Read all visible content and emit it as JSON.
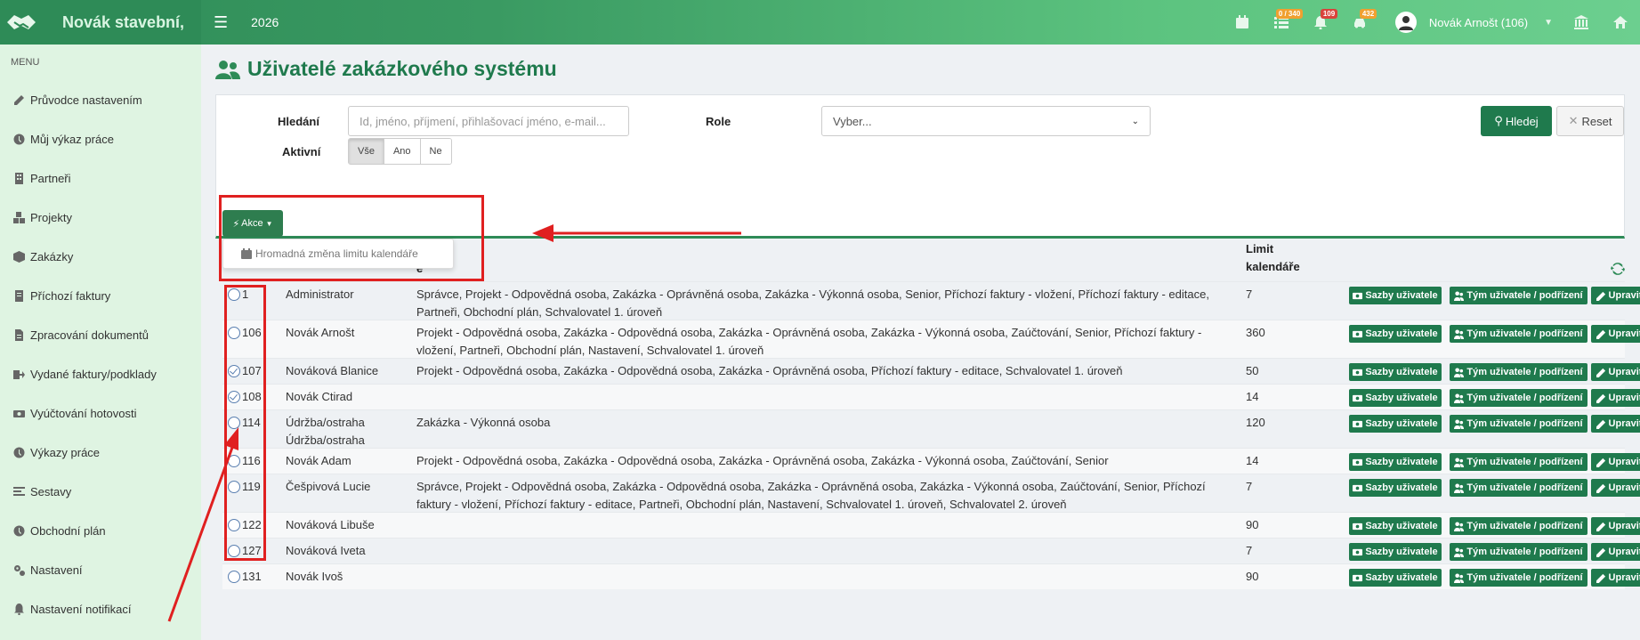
{
  "app": {
    "brand_name": "Novák stavební,",
    "year": "2026",
    "badges": {
      "tasks": "0 / 340",
      "notifications": "109",
      "vehicles": "432"
    },
    "user_name": "Novák Arnošt (106)"
  },
  "sidebar": {
    "menu_title": "MENU",
    "items": [
      {
        "label": "Průvodce nastavením",
        "icon": "pencil-icon"
      },
      {
        "label": "Můj výkaz práce",
        "icon": "clock-icon"
      },
      {
        "label": "Partneři",
        "icon": "building-icon"
      },
      {
        "label": "Projekty",
        "icon": "cubes-icon"
      },
      {
        "label": "Zakázky",
        "icon": "cube-icon"
      },
      {
        "label": "Příchozí faktury",
        "icon": "invoice-icon"
      },
      {
        "label": "Zpracování dokumentů",
        "icon": "document-icon"
      },
      {
        "label": "Vydané faktury/podklady",
        "icon": "export-icon"
      },
      {
        "label": "Vyúčtování hotovosti",
        "icon": "money-icon"
      },
      {
        "label": "Výkazy práce",
        "icon": "clock-icon"
      },
      {
        "label": "Sestavy",
        "icon": "list-icon"
      },
      {
        "label": "Obchodní plán",
        "icon": "clock-icon"
      },
      {
        "label": "Nastavení",
        "icon": "gears-icon"
      },
      {
        "label": "Nastavení notifikací",
        "icon": "bell-icon"
      }
    ]
  },
  "page": {
    "title": "Uživatelé zakázkového systému"
  },
  "filter": {
    "search_label": "Hledání",
    "search_placeholder": "Id, jméno, příjmení, přihlašovací jméno, e-mail...",
    "role_label": "Role",
    "role_value": "Vyber...",
    "active_label": "Aktivní",
    "active_options": [
      "Vše",
      "Ano",
      "Ne"
    ],
    "search_button": "Hledej",
    "reset_button": "Reset"
  },
  "actions": {
    "akce_button": "Akce",
    "dropdown_item": "Hromadná změna limitu kalendáře"
  },
  "table": {
    "header_role_partial": "e",
    "header_limit_line1": "Limit",
    "header_limit_line2": "kalendáře",
    "btn_sazby": "Sazby uživatele",
    "btn_tym": "Tým uživatele / podřízení",
    "btn_upravit": "Upravit",
    "rows": [
      {
        "id": "1",
        "name": "Administrator",
        "roles1": "Správce, Projekt - Odpovědná osoba, Zakázka - Oprávněná osoba, Zakázka - Výkonná osoba, Senior, Příchozí faktury - vložení, Příchozí faktury - editace,",
        "roles2": "Partneři, Obchodní plán, Schvalovatel 1. úroveň",
        "limit": "7",
        "checked": false
      },
      {
        "id": "106",
        "name": "Novák Arnošt",
        "roles1": "Projekt - Odpovědná osoba, Zakázka - Odpovědná osoba, Zakázka - Oprávněná osoba, Zakázka - Výkonná osoba, Zaúčtování, Senior, Příchozí faktury -",
        "roles2": "vložení, Partneři, Obchodní plán, Nastavení, Schvalovatel 1. úroveň",
        "limit": "360",
        "checked": false
      },
      {
        "id": "107",
        "name": "Nováková Blanice",
        "roles1": "Projekt - Odpovědná osoba, Zakázka - Odpovědná osoba, Zakázka - Oprávněná osoba, Příchozí faktury - editace, Schvalovatel 1. úroveň",
        "roles2": "",
        "limit": "50",
        "checked": true
      },
      {
        "id": "108",
        "name": "Novák Ctirad",
        "roles1": "",
        "roles2": "",
        "limit": "14",
        "checked": true
      },
      {
        "id": "114",
        "name": "Údržba/ostraha",
        "name2": "Údržba/ostraha",
        "roles1": "Zakázka - Výkonná osoba",
        "roles2": "",
        "limit": "120",
        "checked": false
      },
      {
        "id": "116",
        "name": "Novák Adam",
        "roles1": "Projekt - Odpovědná osoba, Zakázka - Odpovědná osoba, Zakázka - Oprávněná osoba, Zakázka - Výkonná osoba, Zaúčtování, Senior",
        "roles2": "",
        "limit": "14",
        "checked": false
      },
      {
        "id": "119",
        "name": "Češpivová Lucie",
        "roles1": "Správce, Projekt - Odpovědná osoba, Zakázka - Odpovědná osoba, Zakázka - Oprávněná osoba, Zakázka - Výkonná osoba, Zaúčtování, Senior, Příchozí",
        "roles2": "faktury - vložení, Příchozí faktury - editace, Partneři, Obchodní plán, Nastavení, Schvalovatel 1. úroveň, Schvalovatel 2. úroveň",
        "limit": "7",
        "checked": false
      },
      {
        "id": "122",
        "name": "Nováková Libuše",
        "roles1": "",
        "roles2": "",
        "limit": "90",
        "checked": false
      },
      {
        "id": "127",
        "name": "Nováková Iveta",
        "roles1": "",
        "roles2": "",
        "limit": "7",
        "checked": false
      },
      {
        "id": "131",
        "name": "Novák Ivoš",
        "roles1": "",
        "roles2": "",
        "limit": "90",
        "checked": false
      }
    ]
  },
  "colors": {
    "primary": "#1f7a4d",
    "sidebar_bg": "#dff4e2",
    "annotation": "#e02020"
  }
}
